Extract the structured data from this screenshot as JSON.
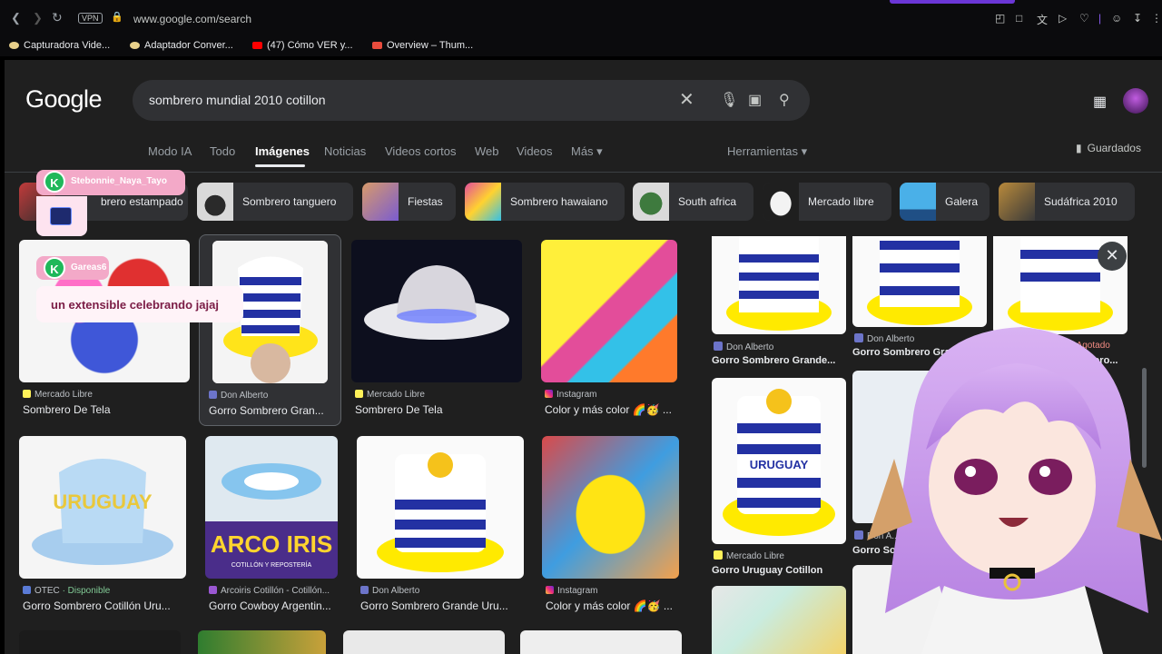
{
  "browser": {
    "url": "www.google.com/search",
    "vpn_label": "VPN",
    "bookmarks": [
      {
        "label": "Capturadora Vide...",
        "color": "#e8d08a"
      },
      {
        "label": "Adaptador Conver...",
        "color": "#e8d08a"
      },
      {
        "label": "(47) Cómo VER y...",
        "color": "#ff0000"
      },
      {
        "label": "Overview – Thum...",
        "color": "#e84c3d"
      }
    ]
  },
  "google": {
    "logo": "Google",
    "query": "sombrero mundial 2010 cotillon",
    "tabs": [
      "Modo IA",
      "Todo",
      "Imágenes",
      "Noticias",
      "Videos cortos",
      "Web",
      "Videos",
      "Más ▾"
    ],
    "active_tab": "Imágenes",
    "tools": "Herramientas ▾",
    "saved": "Guardados",
    "chips": [
      "brero estampado",
      "Sombrero tanguero",
      "Fiestas",
      "Sombrero hawaiano",
      "South africa",
      "Mercado libre",
      "Galera",
      "Sudáfrica 2010"
    ]
  },
  "results": [
    {
      "source": "Mercado Libre",
      "title": "Sombrero De Tela"
    },
    {
      "source": "Don Alberto",
      "title": "Gorro Sombrero Gran..."
    },
    {
      "source": "Mercado Libre",
      "title": "Sombrero De Tela"
    },
    {
      "source": "Instagram",
      "title": "Color y más color 🌈🥳 ..."
    },
    {
      "source": "OTEC",
      "status": "· Disponible",
      "title": "Gorro Sombrero Cotillón Uru..."
    },
    {
      "source": "Arcoiris Cotillón - Cotillón...",
      "title": "Gorro Cowboy Argentin..."
    },
    {
      "source": "Don Alberto",
      "title": "Gorro Sombrero Grande Uru..."
    },
    {
      "source": "Instagram",
      "title": "Color y más color 🌈🥳 ..."
    }
  ],
  "panel": {
    "items": [
      {
        "source": "Don Alberto",
        "title": "Gorro Sombrero Grande..."
      },
      {
        "source": "Don Alberto",
        "title": "Gorro Sombrero Grand..."
      },
      {
        "status": "· Agotado",
        "title": "...ero..."
      },
      {
        "source": "Mercado Libre",
        "title": "Gorro Uruguay Cotillon"
      },
      {
        "source": "Don A...",
        "title": "Gorro Sombrero Gran..."
      }
    ]
  },
  "image_text": {
    "uruguay": "URUGUAY",
    "arcoiris": "ARCO IRIS",
    "arcoiris_sub": "COTILLÓN Y REPOSTERÍA"
  },
  "overlay": {
    "chat1_user": "Stebonnie_Naya_Tayo",
    "chat2_user": "Gareas6",
    "chat2_message": "un extensible celebrando jajaj",
    "badge_letter": "K"
  }
}
